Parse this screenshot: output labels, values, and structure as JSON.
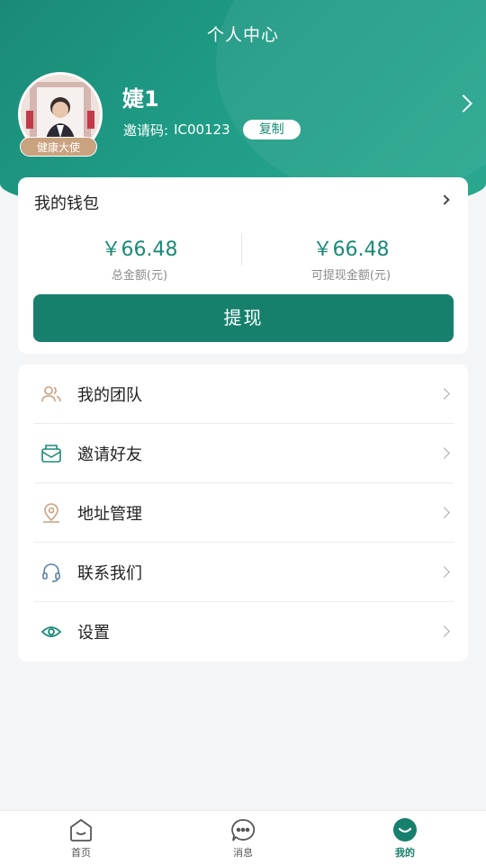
{
  "header": {
    "title": "个人中心"
  },
  "profile": {
    "name": "婕1",
    "badge": "健康大使",
    "invite_label": "邀请码:",
    "invite_code": "IC00123",
    "copy_label": "复制"
  },
  "wallet": {
    "title": "我的钱包",
    "total_amount": "￥66.48",
    "total_label": "总金额(元)",
    "withdrawable_amount": "￥66.48",
    "withdrawable_label": "可提现金额(元)",
    "withdraw_button": "提现"
  },
  "menu": {
    "items": [
      {
        "label": "我的团队",
        "icon": "team-icon"
      },
      {
        "label": "邀请好友",
        "icon": "invite-icon"
      },
      {
        "label": "地址管理",
        "icon": "location-icon"
      },
      {
        "label": "联系我们",
        "icon": "headset-icon"
      },
      {
        "label": "设置",
        "icon": "eye-icon"
      }
    ]
  },
  "tabbar": {
    "tabs": [
      {
        "label": "首页",
        "icon": "home-icon",
        "active": false
      },
      {
        "label": "消息",
        "icon": "message-icon",
        "active": false
      },
      {
        "label": "我的",
        "icon": "profile-icon",
        "active": true
      }
    ]
  },
  "colors": {
    "brand": "#17806d",
    "badge": "#c9a27f"
  }
}
